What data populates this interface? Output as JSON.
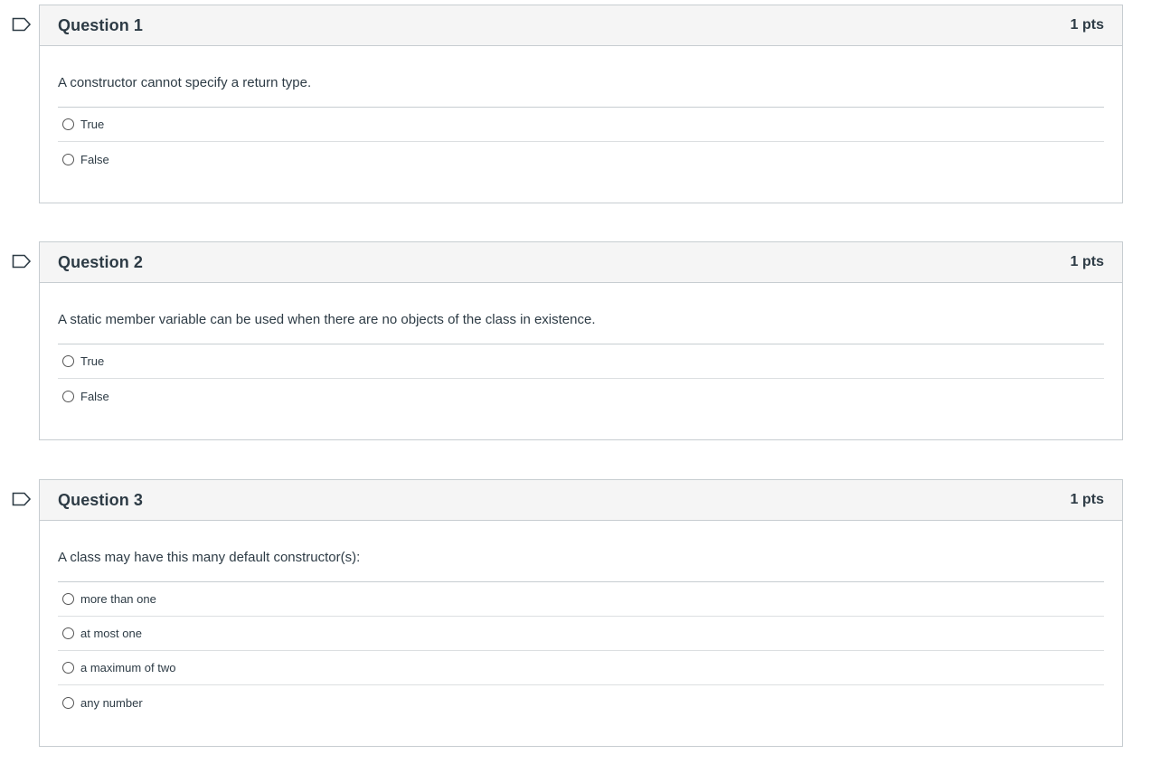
{
  "questions": [
    {
      "title": "Question 1",
      "points": "1 pts",
      "text": "A constructor cannot specify a return type.",
      "answers": [
        "True",
        "False"
      ]
    },
    {
      "title": "Question 2",
      "points": "1 pts",
      "text": "A static member variable can be used when there are no objects of the class in existence.",
      "answers": [
        "True",
        "False"
      ]
    },
    {
      "title": "Question 3",
      "points": "1 pts",
      "text": "A class may have this many default constructor(s):",
      "answers": [
        "more than one",
        "at most one",
        "a maximum of two",
        "any number"
      ]
    }
  ],
  "colors": {
    "flag": "#2d3b45",
    "header_bg": "#f5f5f5",
    "border": "#c7cdd1",
    "text": "#2d3b45"
  },
  "icons": {
    "flag": "bookmark-flag-icon",
    "radio": "radio-unchecked-icon"
  }
}
